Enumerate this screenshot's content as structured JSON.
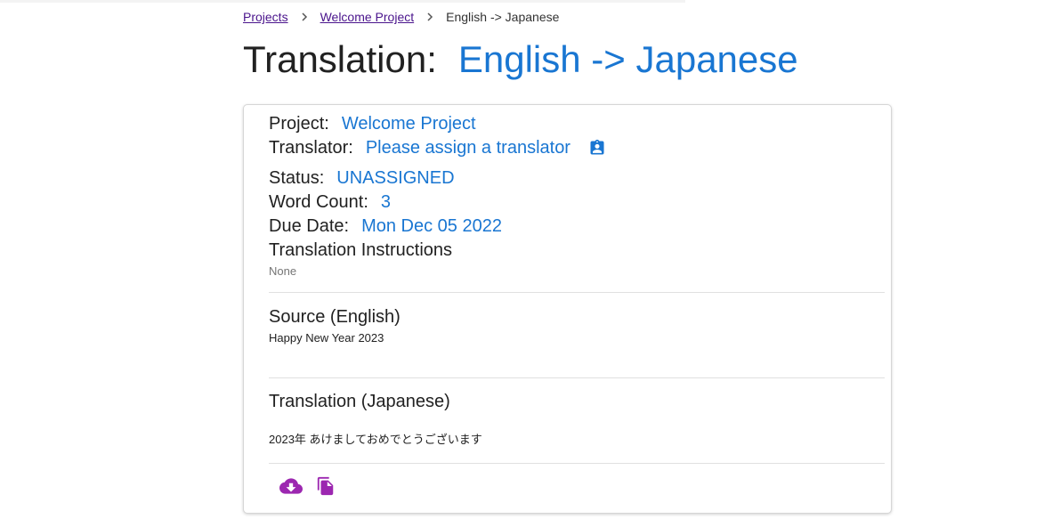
{
  "breadcrumb": {
    "items": [
      {
        "label": "Projects",
        "link": true
      },
      {
        "label": "Welcome Project",
        "link": true
      },
      {
        "label": "English -> Japanese",
        "link": false
      }
    ],
    "separator_icon": "chevron-right-icon"
  },
  "title": {
    "label": "Translation:",
    "value": "English -> Japanese"
  },
  "details": {
    "project_label": "Project:",
    "project_value": "Welcome Project",
    "translator_label": "Translator:",
    "translator_value": "Please assign a translator",
    "translator_icon": "assign-translator-icon",
    "status_label": "Status:",
    "status_value": "UNASSIGNED",
    "word_count_label": "Word Count:",
    "word_count_value": "3",
    "due_date_label": "Due Date:",
    "due_date_value": "Mon Dec 05 2022",
    "instructions_label": "Translation Instructions",
    "instructions_value": "None"
  },
  "source": {
    "heading": "Source (English)",
    "text": "Happy New Year 2023"
  },
  "translation": {
    "heading": "Translation (Japanese)",
    "text": "2023年 あけましておめでとうございます"
  },
  "actions": [
    {
      "icon": "cloud-download-icon"
    },
    {
      "icon": "copy-icon"
    }
  ],
  "colors": {
    "accent_blue": "#1976d2",
    "link_purple": "#4a148c",
    "icon_purple": "#9c27b0"
  }
}
